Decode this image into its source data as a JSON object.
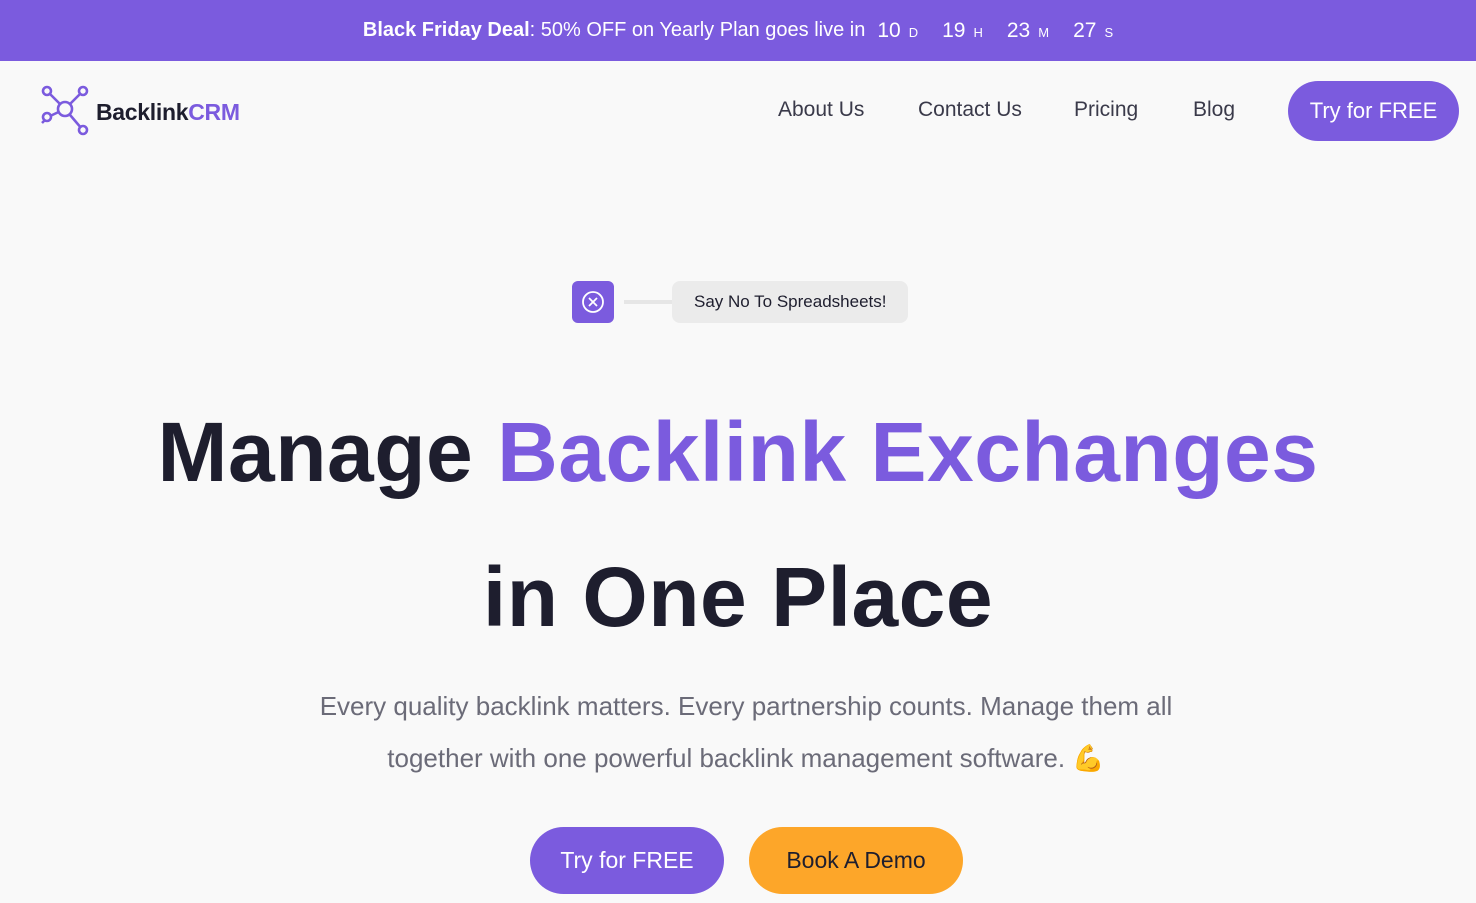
{
  "promo": {
    "deal_strong": "Black Friday Deal",
    "deal_rest": ": 50% OFF on Yearly Plan goes live in",
    "countdown": [
      {
        "value": "10",
        "unit": "D"
      },
      {
        "value": "19",
        "unit": "H"
      },
      {
        "value": "23",
        "unit": "M"
      },
      {
        "value": "27",
        "unit": "S"
      }
    ]
  },
  "logo": {
    "word": "Backlink",
    "accent": "CRM",
    "icon": "network-nodes-icon"
  },
  "nav": {
    "links": [
      "About Us",
      "Contact Us",
      "Pricing",
      "Blog"
    ],
    "cta": "Try for FREE"
  },
  "hero": {
    "tagline_icon": "x-circle-icon",
    "tagline": "Say No To Spreadsheets!",
    "title_part1": "Manage ",
    "title_accent": "Backlink Exchanges",
    "title_line2": "in One Place",
    "subtitle": "Every quality backlink matters. Every partnership counts. Manage them all together with one powerful backlink management software. 💪",
    "buttons": {
      "primary": "Try for FREE",
      "secondary": "Book A Demo"
    }
  },
  "colors": {
    "brand": "#7b5bde",
    "accent_orange": "#fda629",
    "text_dark": "#1e1e2e",
    "background": "#f9f9f9"
  }
}
